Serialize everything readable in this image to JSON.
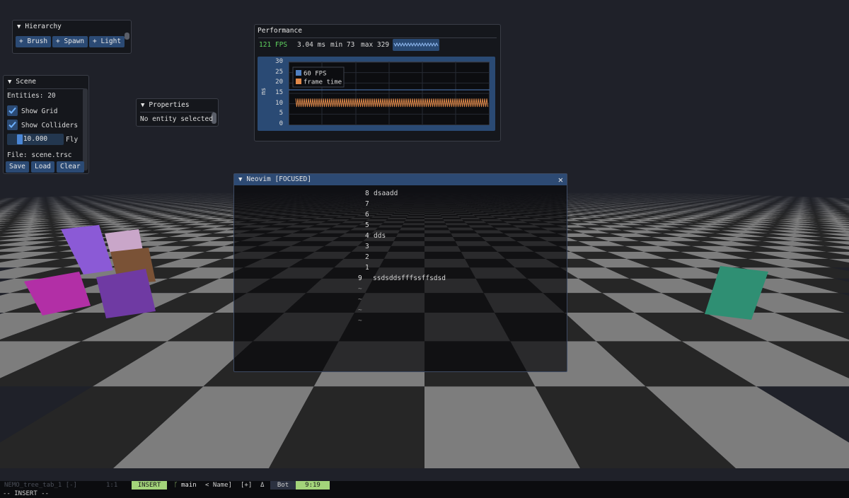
{
  "hierarchy": {
    "title": "Hierarchy",
    "buttons": [
      "+ Brush",
      "+ Spawn",
      "+ Light"
    ]
  },
  "scene": {
    "title": "Scene",
    "entities": "Entities: 20",
    "show_grid": "Show Grid",
    "show_grid_checked": true,
    "show_colliders": "Show Colliders",
    "show_colliders_checked": true,
    "fly_value": "10.000",
    "fly_label": "Fly",
    "file": "File: scene.trsc",
    "save": "Save",
    "load": "Load",
    "clear": "Clear"
  },
  "properties": {
    "title": "Properties",
    "empty": "No entity selected"
  },
  "performance": {
    "title": "Performance",
    "fps": "121 FPS",
    "frame_ms": "3.04 ms",
    "min": "min 73",
    "max": "max 329",
    "legend": [
      "60 FPS",
      "frame time"
    ],
    "y_label": "ms",
    "y_ticks": [
      "30",
      "25",
      "20",
      "15",
      "10",
      "5",
      "0"
    ],
    "colors": {
      "fps_text": "#5fd35f",
      "line_60fps": "#4f7fc0",
      "frame_time": "#e0894a"
    }
  },
  "chart_data": {
    "type": "line",
    "series": [
      {
        "name": "60 FPS",
        "value": 16.7
      },
      {
        "name": "frame time",
        "min": 8.5,
        "max": 12.5
      }
    ],
    "ylabel": "ms",
    "ylim": [
      0,
      30
    ]
  },
  "nvim": {
    "title": "Neovim [FOCUSED]",
    "lines": [
      {
        "num": "8",
        "text": "dsaadd"
      },
      {
        "num": "7",
        "text": ""
      },
      {
        "num": "6",
        "text": ""
      },
      {
        "num": "5",
        "text": ""
      },
      {
        "num": "4",
        "text": "dds"
      },
      {
        "num": "3",
        "text": ""
      },
      {
        "num": "2",
        "text": ""
      },
      {
        "num": "1",
        "text": ""
      },
      {
        "num": "9",
        "text": "ssdsddsfffssffsdsd",
        "current": true
      }
    ],
    "tildes": [
      "~",
      "~",
      "~",
      "~"
    ]
  },
  "statusline": {
    "buffer": "NEMO_tree_tab_1 [-]",
    "pos": "1:1",
    "mode": "INSERT",
    "branch": "main",
    "name": "< Name]",
    "modified": "[+]",
    "delta": "Δ",
    "bot": "Bot",
    "cursor": "9:19",
    "cmdline": "-- INSERT --"
  }
}
